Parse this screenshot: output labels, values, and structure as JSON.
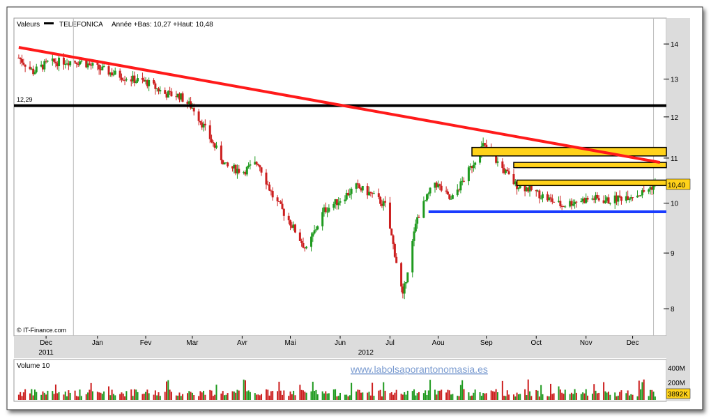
{
  "header": {
    "label": "Valeurs",
    "ticker": "TELEFONICA",
    "range_text": "Année +Bas: 10,27 +Haut: 10,48"
  },
  "colors": {
    "up": "#1f9a1f",
    "down": "#cc1f1f",
    "trendline": "#ff1a1a",
    "support": "#1a3cff",
    "zone": "#ffd21a",
    "hline": "#000000",
    "price_badge": "#ffd21a"
  },
  "credit": "© IT-Finance.com",
  "watermark": "www.labolsaporantonomasia.es",
  "chart_data": [
    {
      "type": "candlestick",
      "title": "TELEFONICA",
      "y_scale": "log",
      "ylim": [
        7.6,
        14.7
      ],
      "y_ticks": [
        "14",
        "13",
        "12",
        "11",
        "10",
        "9",
        "8"
      ],
      "x_ticks": [
        "Dec",
        "Jan",
        "Fev",
        "Mar",
        "Avr",
        "Mai",
        "Jun",
        "Jul",
        "Aou",
        "Sep",
        "Oct",
        "Nov",
        "Dec"
      ],
      "x_year_labels": [
        "2011",
        "2012"
      ],
      "last_price_label": "10,40",
      "last_price": 10.4,
      "level_label": "12,29",
      "horizontal_line": 12.29,
      "support_line": 9.82,
      "trendline": {
        "start": [
          "2011-11-28",
          13.9
        ],
        "end": [
          "2012-12-31",
          10.9
        ]
      },
      "resistance_zones": [
        {
          "from": "2012-09-05",
          "low": 11.05,
          "high": 11.25
        },
        {
          "from": "2012-10-01",
          "low": 10.78,
          "high": 10.9
        },
        {
          "from": "2012-10-03",
          "low": 10.38,
          "high": 10.5
        }
      ],
      "series": [
        {
          "name": "TELEFONICA",
          "x": [
            "2011-11-28",
            "2011-12-07",
            "2011-12-16",
            "2011-12-27",
            "2012-01-05",
            "2012-01-16",
            "2012-01-26",
            "2012-02-06",
            "2012-02-16",
            "2012-02-27",
            "2012-03-07",
            "2012-03-16",
            "2012-03-27",
            "2012-04-05",
            "2012-04-16",
            "2012-04-25",
            "2012-05-04",
            "2012-05-15",
            "2012-05-25",
            "2012-06-05",
            "2012-06-14",
            "2012-06-25",
            "2012-07-04",
            "2012-07-13",
            "2012-07-24",
            "2012-08-02",
            "2012-08-13",
            "2012-08-23",
            "2012-09-03",
            "2012-09-12",
            "2012-09-21",
            "2012-10-02",
            "2012-10-11",
            "2012-10-22",
            "2012-10-31",
            "2012-11-09",
            "2012-11-20",
            "2012-11-29",
            "2012-12-10",
            "2012-12-19",
            "2012-12-28"
          ],
          "values": [
            13.6,
            13.2,
            13.45,
            13.5,
            13.5,
            13.3,
            13.15,
            13.0,
            12.9,
            12.6,
            12.55,
            12.2,
            11.4,
            10.8,
            10.7,
            10.9,
            10.15,
            9.6,
            9.05,
            9.85,
            10.05,
            10.35,
            10.2,
            9.95,
            8.2,
            9.7,
            10.45,
            10.05,
            10.7,
            11.3,
            10.9,
            10.4,
            10.3,
            10.1,
            9.95,
            10.05,
            10.1,
            10.05,
            10.15,
            10.2,
            10.4
          ]
        }
      ],
      "volume": {
        "label": "Volume 10",
        "y_ticks": [
          "400M",
          "200M"
        ],
        "last_label": "3892K"
      }
    }
  ]
}
